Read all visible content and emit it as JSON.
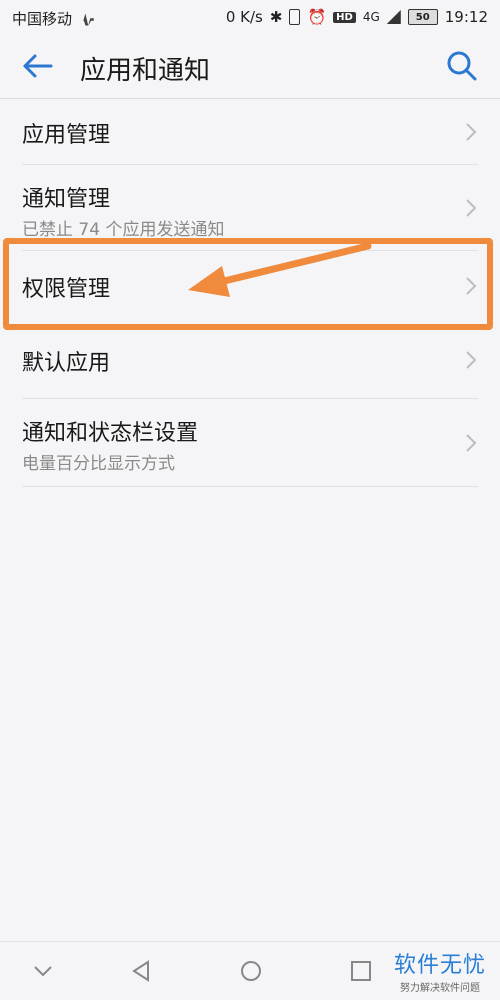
{
  "status_bar": {
    "carrier": "中国移动",
    "speed": "0 K/s",
    "network": "4G",
    "hd": "HD",
    "battery": "50",
    "time": "19:12"
  },
  "header": {
    "title": "应用和通知"
  },
  "list": [
    {
      "label": "应用管理",
      "sub": ""
    },
    {
      "label": "通知管理",
      "sub": "已禁止 74 个应用发送通知"
    },
    {
      "label": "权限管理",
      "sub": ""
    },
    {
      "label": "默认应用",
      "sub": ""
    },
    {
      "label": "通知和状态栏设置",
      "sub": "电量百分比显示方式"
    }
  ],
  "annotation_color": "#f08a3c",
  "watermark": {
    "main": "软件无忧",
    "sub": "努力解决软件问题"
  }
}
